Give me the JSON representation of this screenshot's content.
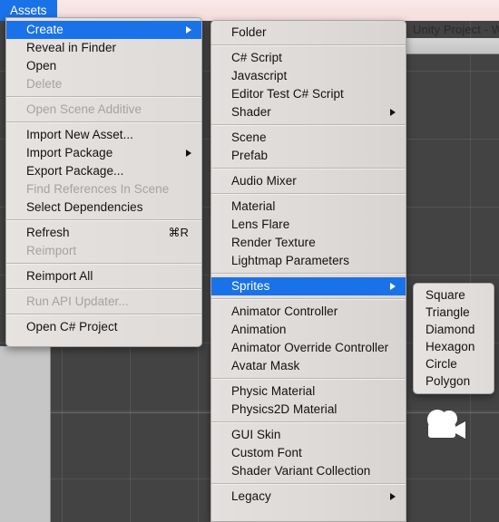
{
  "window": {
    "title": "Unity Project - W",
    "menu_title": "Assets"
  },
  "scene": {
    "camera_gizmo_icon": "camera-gizmo-icon"
  },
  "menus": {
    "assets": {
      "name": "Assets",
      "items": [
        {
          "label": "Create",
          "state": "highlight",
          "submenu": true
        },
        {
          "label": "Reveal in Finder",
          "state": "normal"
        },
        {
          "label": "Open",
          "state": "normal"
        },
        {
          "label": "Delete",
          "state": "disabled"
        },
        {
          "separator": true
        },
        {
          "label": "Open Scene Additive",
          "state": "disabled"
        },
        {
          "separator": true
        },
        {
          "label": "Import New Asset...",
          "state": "normal"
        },
        {
          "label": "Import Package",
          "state": "normal",
          "submenu": true
        },
        {
          "label": "Export Package...",
          "state": "normal"
        },
        {
          "label": "Find References In Scene",
          "state": "disabled"
        },
        {
          "label": "Select Dependencies",
          "state": "normal"
        },
        {
          "separator": true
        },
        {
          "label": "Refresh",
          "state": "normal",
          "shortcut": "⌘R"
        },
        {
          "label": "Reimport",
          "state": "disabled"
        },
        {
          "separator": true
        },
        {
          "label": "Reimport All",
          "state": "normal"
        },
        {
          "separator": true
        },
        {
          "label": "Run API Updater...",
          "state": "disabled"
        },
        {
          "separator": true
        },
        {
          "label": "Open C# Project",
          "state": "normal"
        }
      ]
    },
    "create": {
      "name": "Create",
      "items": [
        {
          "label": "Folder",
          "state": "normal"
        },
        {
          "separator": true
        },
        {
          "label": "C# Script",
          "state": "normal"
        },
        {
          "label": "Javascript",
          "state": "normal"
        },
        {
          "label": "Editor Test C# Script",
          "state": "normal"
        },
        {
          "label": "Shader",
          "state": "normal",
          "submenu": true
        },
        {
          "separator": true
        },
        {
          "label": "Scene",
          "state": "normal"
        },
        {
          "label": "Prefab",
          "state": "normal"
        },
        {
          "separator": true
        },
        {
          "label": "Audio Mixer",
          "state": "normal"
        },
        {
          "separator": true
        },
        {
          "label": "Material",
          "state": "normal"
        },
        {
          "label": "Lens Flare",
          "state": "normal"
        },
        {
          "label": "Render Texture",
          "state": "normal"
        },
        {
          "label": "Lightmap Parameters",
          "state": "normal"
        },
        {
          "separator": true
        },
        {
          "label": "Sprites",
          "state": "highlight",
          "submenu": true
        },
        {
          "separator": true
        },
        {
          "label": "Animator Controller",
          "state": "normal"
        },
        {
          "label": "Animation",
          "state": "normal"
        },
        {
          "label": "Animator Override Controller",
          "state": "normal"
        },
        {
          "label": "Avatar Mask",
          "state": "normal"
        },
        {
          "separator": true
        },
        {
          "label": "Physic Material",
          "state": "normal"
        },
        {
          "label": "Physics2D Material",
          "state": "normal"
        },
        {
          "separator": true
        },
        {
          "label": "GUI Skin",
          "state": "normal"
        },
        {
          "label": "Custom Font",
          "state": "normal"
        },
        {
          "label": "Shader Variant Collection",
          "state": "normal"
        },
        {
          "separator": true
        },
        {
          "label": "Legacy",
          "state": "normal",
          "submenu": true
        }
      ]
    },
    "sprites": {
      "name": "Sprites",
      "items": [
        {
          "label": "Square",
          "state": "normal"
        },
        {
          "label": "Triangle",
          "state": "normal"
        },
        {
          "label": "Diamond",
          "state": "normal"
        },
        {
          "label": "Hexagon",
          "state": "normal"
        },
        {
          "label": "Circle",
          "state": "normal"
        },
        {
          "label": "Polygon",
          "state": "normal"
        }
      ]
    }
  },
  "colors": {
    "highlight": "#1a72e8",
    "menu_bg": "#e2dfdd",
    "scene_bg": "#434343",
    "titlebar": "#f7e2e2"
  }
}
